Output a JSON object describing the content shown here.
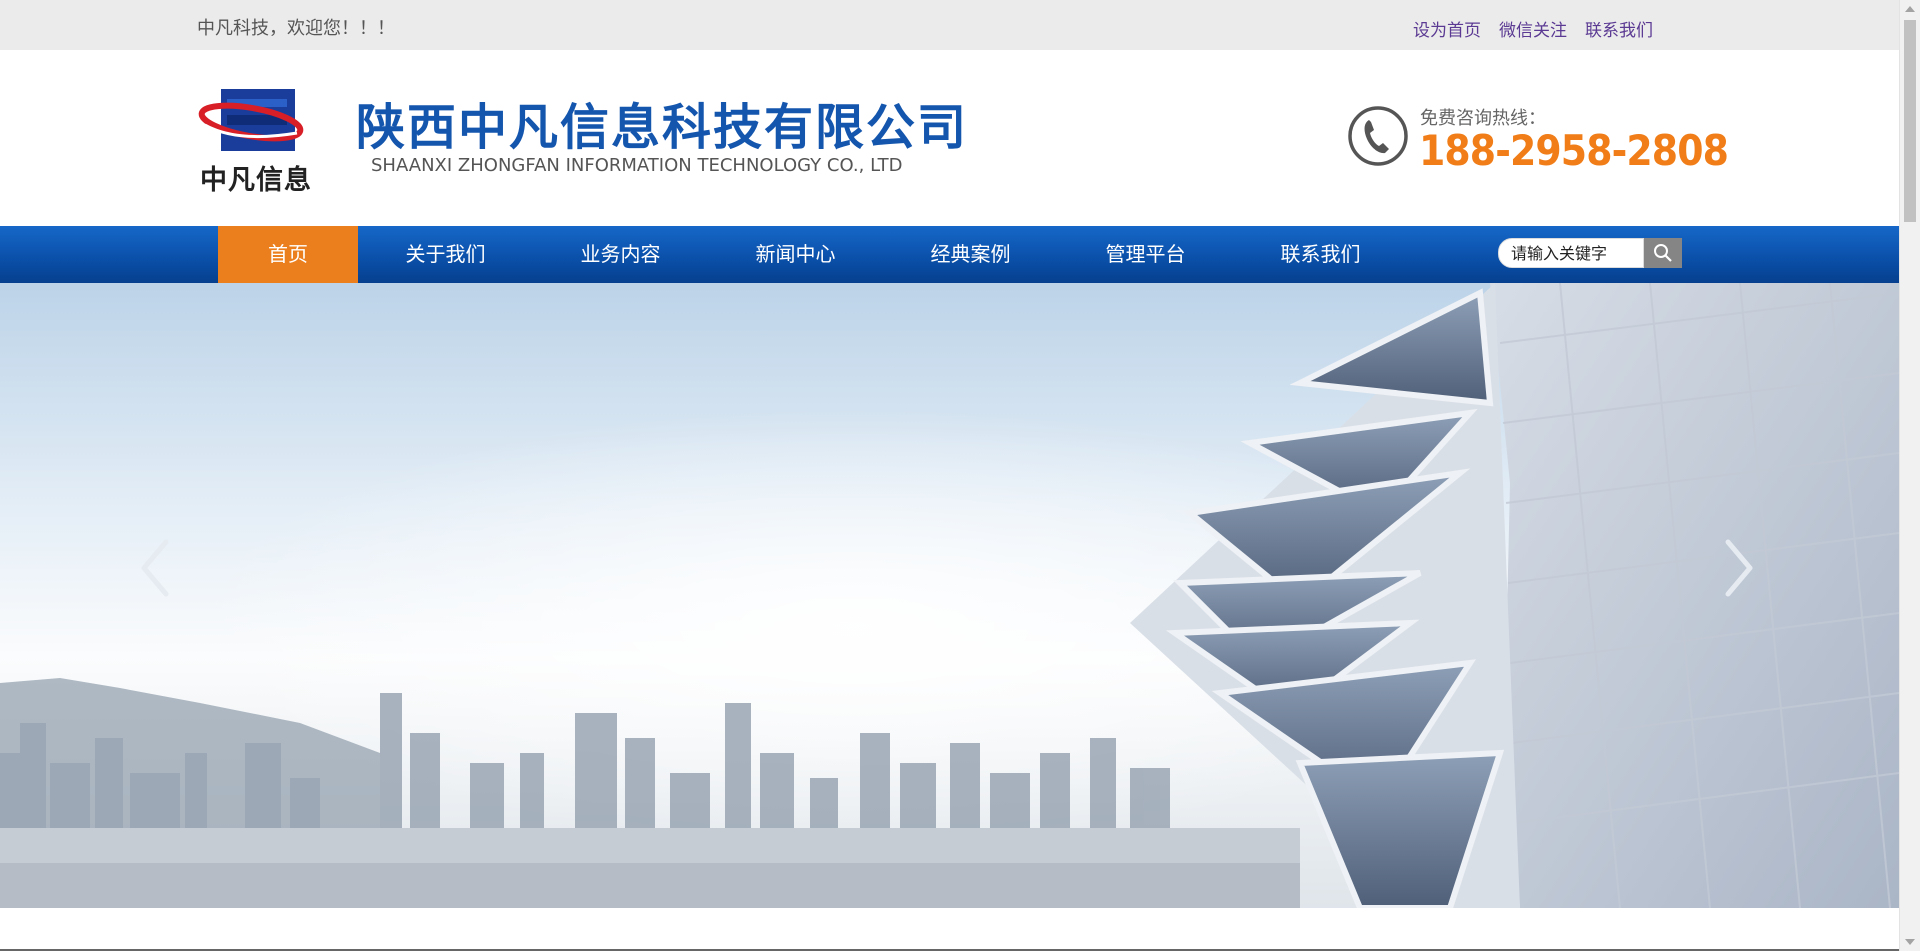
{
  "topbar": {
    "welcome": "中凡科技，欢迎您！！！",
    "links": [
      "设为首页",
      "微信关注",
      "联系我们"
    ],
    "link_color": "#5b3a93"
  },
  "header": {
    "logo_text": "中凡信息",
    "company_cn": "陕西中凡信息科技有限公司",
    "company_en": "SHAANXI ZHONGFAN INFORMATION TECHNOLOGY CO., LTD",
    "hotline_label": "免费咨询热线：",
    "hotline_number": "188-2958-2808",
    "brand_blue": "#1456ae",
    "hotline_color": "#f07d17"
  },
  "nav": {
    "items": [
      "首页",
      "关于我们",
      "业务内容",
      "新闻中心",
      "经典案例",
      "管理平台",
      "联系我们"
    ],
    "active_index": 0,
    "active_color": "#ec7f1d",
    "bar_color": "#0a4fa8"
  },
  "search": {
    "placeholder": "请输入关键字",
    "icon": "search-icon"
  },
  "banner": {
    "left_arrow": "chevron-left-icon",
    "right_arrow": "chevron-right-icon"
  }
}
